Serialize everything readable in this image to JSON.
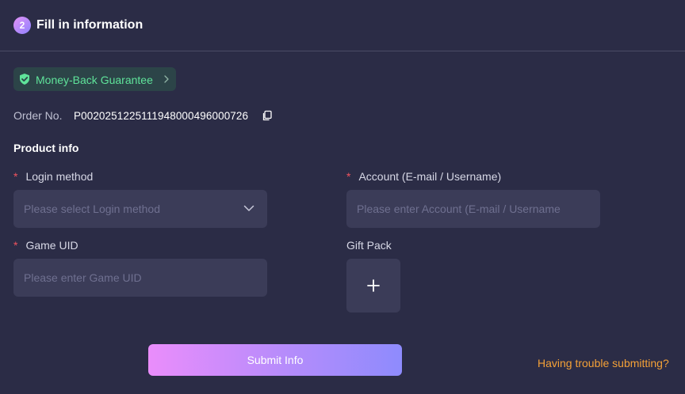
{
  "header": {
    "step_number": "2",
    "title": "Fill in information"
  },
  "guarantee": {
    "label": "Money-Back Guarantee",
    "color": "#5fe39a",
    "icon": "shield-check-icon"
  },
  "order": {
    "label": "Order No.",
    "value": "P00202512251119480004960007 26",
    "icon": "copy-icon"
  },
  "product_info": {
    "title": "Product info",
    "fields": {
      "login_method": {
        "label": "Login method",
        "required": "*",
        "placeholder": "Please select Login method"
      },
      "account": {
        "label": "Account (E-mail / Username)",
        "required": "*",
        "placeholder": "Please enter Account (E-mail / Username"
      },
      "game_uid": {
        "label": "Game UID",
        "required": "*",
        "placeholder": "Please enter Game UID"
      },
      "gift_pack": {
        "label": "Gift Pack",
        "icon": "plus-icon"
      }
    }
  },
  "actions": {
    "submit_label": "Submit Info",
    "trouble_link": "Having trouble submitting?"
  },
  "colors": {
    "background": "#2b2c46",
    "input_background": "#3b3c58",
    "required": "#f0535e",
    "link": "#f4a137"
  }
}
